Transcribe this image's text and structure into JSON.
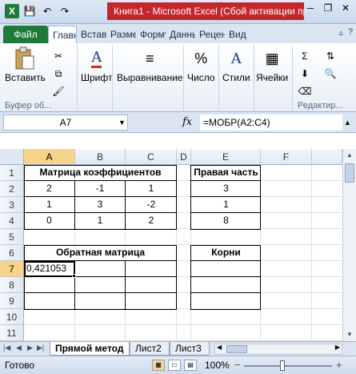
{
  "window": {
    "title": "Книга1  -  Microsoft Excel (Сбой активации продукта)",
    "minimize": "─",
    "restore": "❐",
    "close": "✕"
  },
  "qat": {
    "app_icon": "X",
    "save_icon": "💾",
    "undo_icon": "↶",
    "redo_icon": "↷"
  },
  "ribbon_tabs": [
    {
      "label": "Файл"
    },
    {
      "label": "Главная"
    },
    {
      "label": "Вставка"
    },
    {
      "label": "Разметка"
    },
    {
      "label": "Формулы"
    },
    {
      "label": "Данные"
    },
    {
      "label": "Рецензирование"
    },
    {
      "label": "Вид"
    }
  ],
  "ribbon_tab_icons": {
    "help": "?",
    "minimize_ribbon": "▵"
  },
  "ribbon": {
    "paste_label": "Вставить",
    "clipboard_group": "Буфер об...",
    "font_label": "Шрифт",
    "alignment_label": "Выравнивание",
    "number_label": "Число",
    "styles_label": "Стили",
    "cells_label": "Ячейки",
    "editing_group": "Редактир..."
  },
  "formula_bar": {
    "name_box": "A7",
    "fx": "fx",
    "formula": "=МОБР(A2:C4)"
  },
  "columns": [
    "A",
    "B",
    "C",
    "D",
    "E",
    "F"
  ],
  "rows": [
    "1",
    "2",
    "3",
    "4",
    "5",
    "6",
    "7",
    "8",
    "9",
    "10",
    "11"
  ],
  "cells": {
    "r1_title": "Матрица коэффициентов",
    "r1_right": "Правая часть",
    "r2": [
      "2",
      "-1",
      "1",
      "3"
    ],
    "r3": [
      "1",
      "3",
      "-2",
      "1"
    ],
    "r4": [
      "0",
      "1",
      "2",
      "8"
    ],
    "r6_inverse": "Обратная матрица",
    "r6_roots": "Корни",
    "a7": "0,421053"
  },
  "sheets": [
    {
      "label": "Прямой метод",
      "active": true
    },
    {
      "label": "Лист2",
      "active": false
    },
    {
      "label": "Лист3",
      "active": false
    }
  ],
  "status": {
    "ready": "Готово",
    "zoom": "100%"
  }
}
